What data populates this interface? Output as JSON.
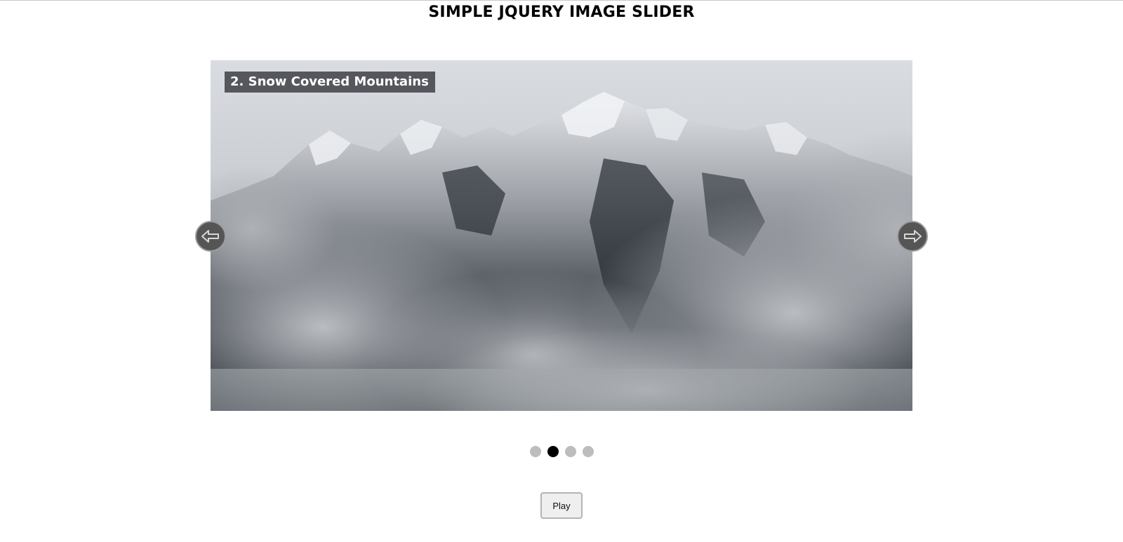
{
  "page": {
    "title": "SIMPLE JQUERY IMAGE SLIDER"
  },
  "slider": {
    "caption": "2. Snow Covered Mountains",
    "image_subject": "snow-covered mountain range rising above clouds",
    "prev_icon": "arrow-left-icon",
    "next_icon": "arrow-right-icon",
    "slide_count": 4,
    "active_slide": 2
  },
  "controls": {
    "play_label": "Play"
  },
  "colors": {
    "caption_background": "#4e5054",
    "arrow_background": "#555555",
    "dot_inactive": "#bdbdbd",
    "dot_active": "#000000"
  }
}
